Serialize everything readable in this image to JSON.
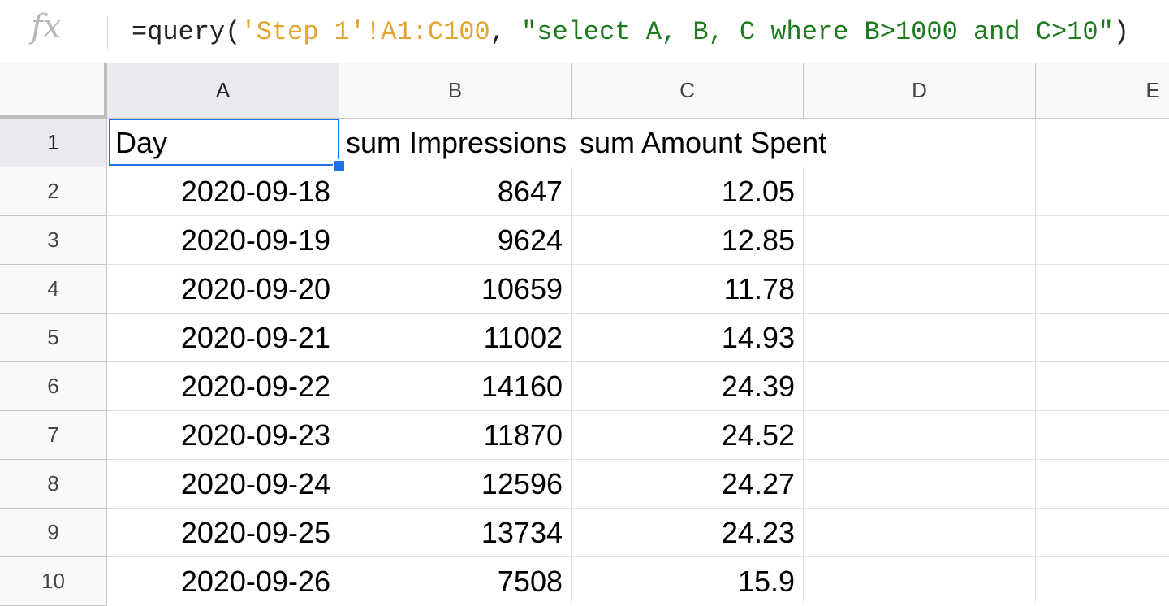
{
  "formula_bar": {
    "fx_label": "fx",
    "formula_prefix": "=query(",
    "formula_range": "'Step 1'!A1:C100",
    "formula_sep": ", ",
    "formula_string": "\"select A, B, C where B>1000 and C>10\"",
    "formula_suffix": ")"
  },
  "columns": [
    "A",
    "B",
    "C",
    "D",
    "E"
  ],
  "rows": [
    "1",
    "2",
    "3",
    "4",
    "5",
    "6",
    "7",
    "8",
    "9",
    "10"
  ],
  "header_row": {
    "day": "Day",
    "impressions": "sum Impressions",
    "amount": "sum Amount Spent"
  },
  "data_rows": [
    {
      "day": "2020-09-18",
      "impressions": "8647",
      "amount": "12.05"
    },
    {
      "day": "2020-09-19",
      "impressions": "9624",
      "amount": "12.85"
    },
    {
      "day": "2020-09-20",
      "impressions": "10659",
      "amount": "11.78"
    },
    {
      "day": "2020-09-21",
      "impressions": "11002",
      "amount": "14.93"
    },
    {
      "day": "2020-09-22",
      "impressions": "14160",
      "amount": "24.39"
    },
    {
      "day": "2020-09-23",
      "impressions": "11870",
      "amount": "24.52"
    },
    {
      "day": "2020-09-24",
      "impressions": "12596",
      "amount": "24.27"
    },
    {
      "day": "2020-09-25",
      "impressions": "13734",
      "amount": "24.23"
    },
    {
      "day": "2020-09-26",
      "impressions": "7508",
      "amount": "15.9"
    }
  ],
  "colors": {
    "selection": "#1a73e8",
    "formula_range": "#e5a42f",
    "formula_string": "#1e7a1e"
  },
  "icons": {
    "formula": "fx-icon",
    "fill_handle": "fill-handle-icon"
  }
}
